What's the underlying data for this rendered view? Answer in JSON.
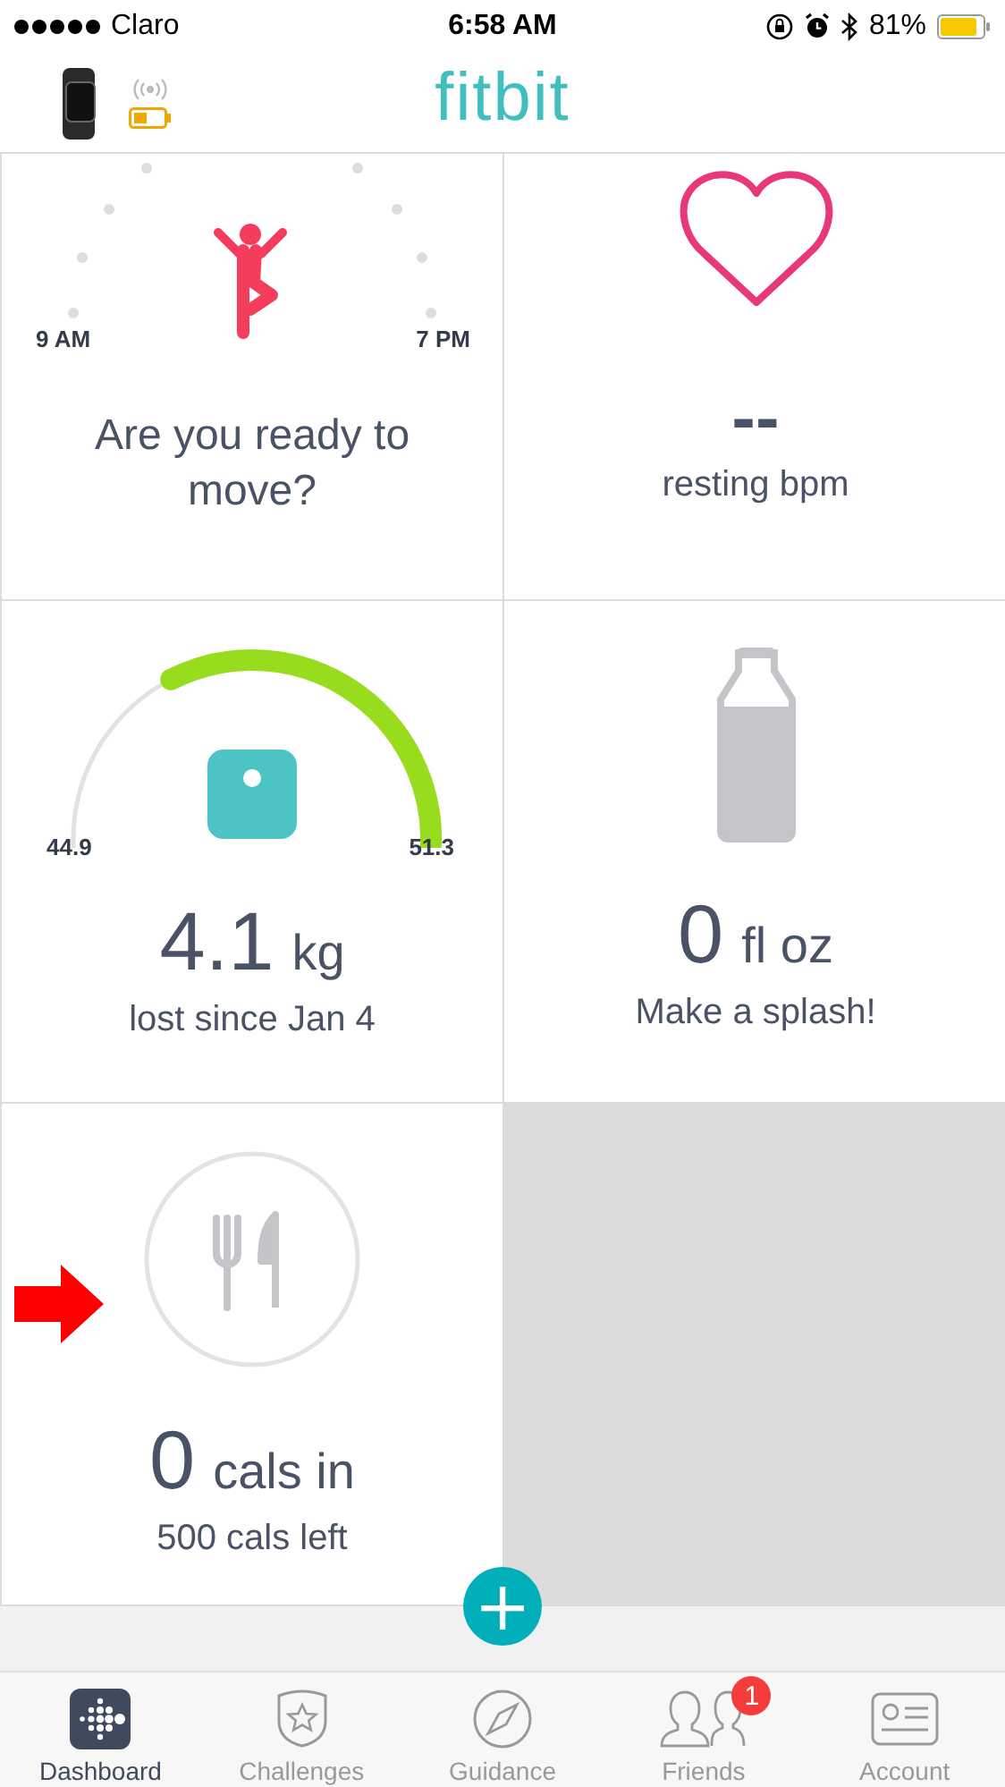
{
  "status_bar": {
    "carrier": "Claro",
    "time": "6:58 AM",
    "battery": "81%"
  },
  "header": {
    "logo": "fitbit"
  },
  "tiles": [
    {
      "kind": "hourly",
      "start": "9 AM",
      "end": "7 PM",
      "text": "Are you ready to move?"
    },
    {
      "kind": "heart",
      "value": "--",
      "caption": "resting bpm"
    },
    {
      "kind": "weight",
      "min": "44.9",
      "max": "51.3",
      "value": "4.1",
      "unit": "kg",
      "caption": "lost since Jan 4"
    },
    {
      "kind": "water",
      "value": "0",
      "unit": "fl oz",
      "caption": "Make a splash!"
    },
    {
      "kind": "food",
      "value": "0",
      "unit": "cals in",
      "caption": "500 cals left"
    }
  ],
  "add_button": {
    "label": "+"
  },
  "tab_bar": [
    {
      "label": "Dashboard",
      "selected": true
    },
    {
      "label": "Challenges",
      "selected": false
    },
    {
      "label": "Guidance",
      "selected": false
    },
    {
      "label": "Friends",
      "selected": false,
      "badge": "1"
    },
    {
      "label": "Account",
      "selected": false
    }
  ]
}
